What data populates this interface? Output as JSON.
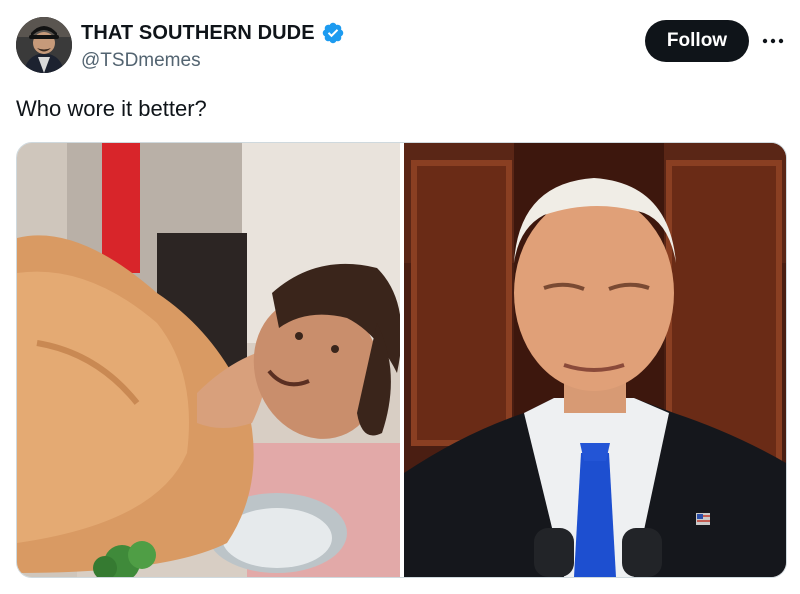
{
  "tweet": {
    "author": {
      "display_name": "THAT SOUTHERN DUDE",
      "handle": "@TSDmemes",
      "verified": true,
      "avatar_icon": "profile-avatar"
    },
    "follow_label": "Follow",
    "more_icon": "more-options-icon",
    "text": "Who wore it better?",
    "media": [
      {
        "icon": "roast-turkey-costume-photo"
      },
      {
        "icon": "man-in-suit-photo"
      }
    ]
  },
  "colors": {
    "verified_badge": "#1d9bf0",
    "follow_button_bg": "#0f1419",
    "handle_text": "#536471"
  }
}
